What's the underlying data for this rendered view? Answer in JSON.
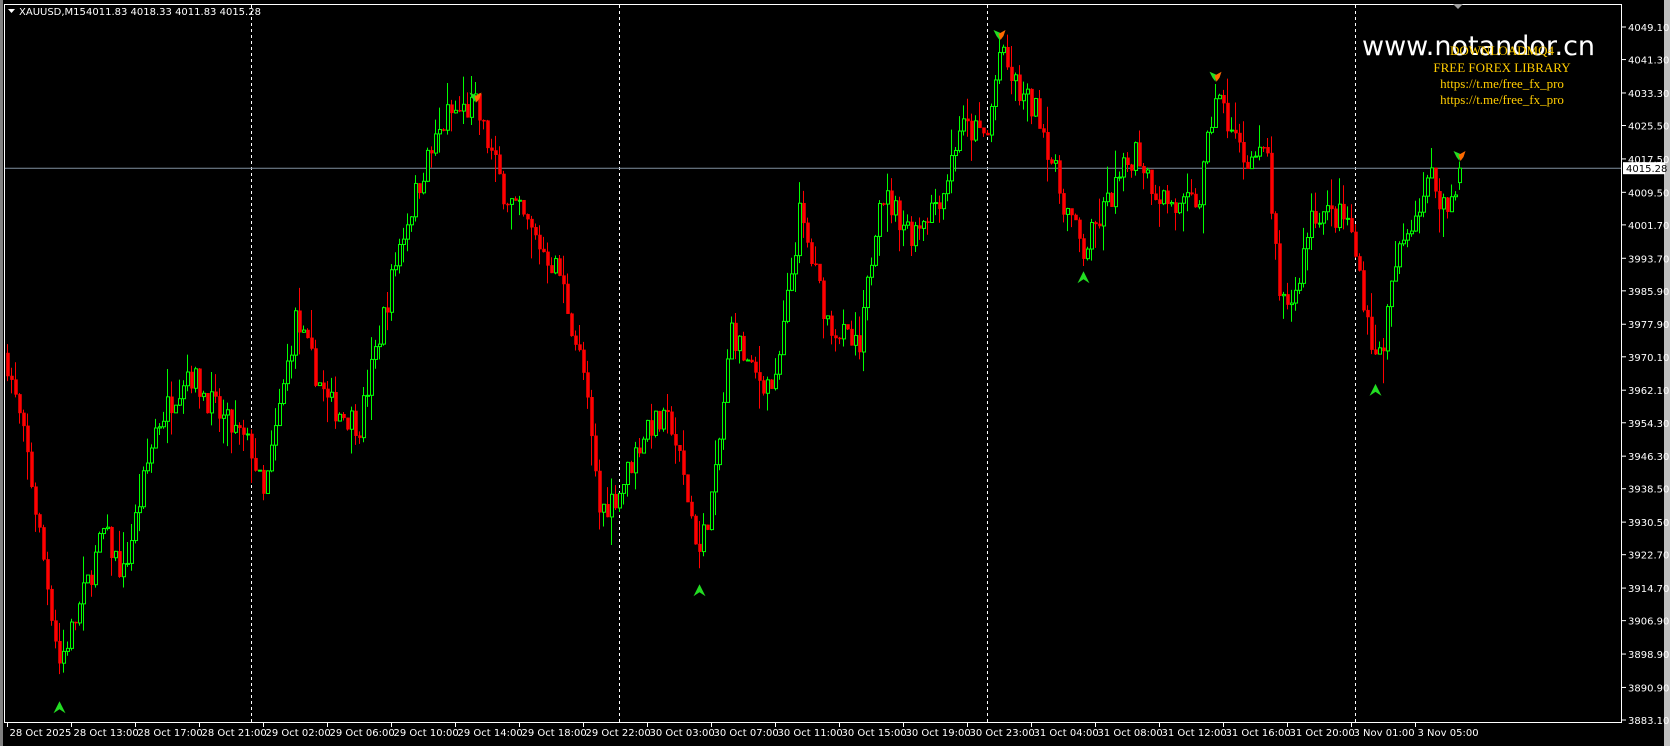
{
  "header": {
    "symbol": "XAUUSD,M15",
    "ohlc": "4011.83 4018.33 4011.83 4015.28"
  },
  "watermark": "www.notandor.cn",
  "ads": [
    "DOWNLOADMQ4",
    "FREE FOREX LIBRARY",
    "https://t.me/free_fx_pro",
    "https://t.me/free_fx_pro"
  ],
  "colors": {
    "bull": "#00ff00",
    "bear": "#ff0000",
    "background": "#000000",
    "axis": "#ffffff",
    "price_line": "#8090a0",
    "ad_text": "#ffcc00"
  },
  "chart_data": {
    "type": "candlestick",
    "symbol": "XAUUSD",
    "timeframe": "M15",
    "current_price": 4015.28,
    "current_price_label": "4015.28",
    "ylim": [
      3883.1,
      4049.1
    ],
    "y_ticks": [
      "4049.10",
      "4041.30",
      "4033.30",
      "4025.50",
      "4017.50",
      "4009.50",
      "4001.70",
      "3993.70",
      "3985.90",
      "3977.90",
      "3970.10",
      "3962.10",
      "3954.30",
      "3946.30",
      "3938.50",
      "3930.50",
      "3922.70",
      "3914.70",
      "3906.90",
      "3898.90",
      "3890.90",
      "3883.10"
    ],
    "x_ticks": [
      "28 Oct 2025",
      "28 Oct 13:00",
      "28 Oct 17:00",
      "28 Oct 21:00",
      "29 Oct 02:00",
      "29 Oct 06:00",
      "29 Oct 10:00",
      "29 Oct 14:00",
      "29 Oct 18:00",
      "29 Oct 22:00",
      "30 Oct 03:00",
      "30 Oct 07:00",
      "30 Oct 11:00",
      "30 Oct 15:00",
      "30 Oct 19:00",
      "30 Oct 23:00",
      "31 Oct 04:00",
      "31 Oct 08:00",
      "31 Oct 12:00",
      "31 Oct 16:00",
      "31 Oct 20:00",
      "3 Nov 01:00",
      "3 Nov 05:00"
    ],
    "bars_per_x_tick": 16,
    "day_separators_bar": [
      61,
      153,
      245,
      337
    ],
    "close_path_bar_price": [
      [
        0,
        3969
      ],
      [
        5,
        3946
      ],
      [
        13,
        3897
      ],
      [
        17,
        3907
      ],
      [
        24,
        3928
      ],
      [
        29,
        3918
      ],
      [
        37,
        3953
      ],
      [
        45,
        3967
      ],
      [
        53,
        3956
      ],
      [
        61,
        3948
      ],
      [
        64,
        3936
      ],
      [
        72,
        3979
      ],
      [
        80,
        3959
      ],
      [
        88,
        3954
      ],
      [
        98,
        3997
      ],
      [
        104,
        4015
      ],
      [
        110,
        4028
      ],
      [
        117,
        4030
      ],
      [
        124,
        4010
      ],
      [
        133,
        3997
      ],
      [
        138,
        3990
      ],
      [
        144,
        3966
      ],
      [
        148,
        3933
      ],
      [
        153,
        3938
      ],
      [
        160,
        3954
      ],
      [
        166,
        3954
      ],
      [
        173,
        3923
      ],
      [
        177,
        3941
      ],
      [
        181,
        3977
      ],
      [
        186,
        3966
      ],
      [
        192,
        3963
      ],
      [
        198,
        4004
      ],
      [
        205,
        3979
      ],
      [
        213,
        3971
      ],
      [
        218,
        4010
      ],
      [
        226,
        4000
      ],
      [
        234,
        4010
      ],
      [
        238,
        4025
      ],
      [
        245,
        4023
      ],
      [
        248,
        4043
      ],
      [
        253,
        4033
      ],
      [
        258,
        4028
      ],
      [
        263,
        4010
      ],
      [
        269,
        3995
      ],
      [
        274,
        4005
      ],
      [
        282,
        4020
      ],
      [
        287,
        4010
      ],
      [
        293,
        4005
      ],
      [
        298,
        4008
      ],
      [
        302,
        4033
      ],
      [
        309,
        4018
      ],
      [
        315,
        4018
      ],
      [
        318,
        3982
      ],
      [
        322,
        3985
      ],
      [
        326,
        4005
      ],
      [
        335,
        4003
      ],
      [
        338,
        3990
      ],
      [
        342,
        3969
      ],
      [
        344,
        3974
      ],
      [
        347,
        3992
      ],
      [
        351,
        4003
      ],
      [
        356,
        4013
      ],
      [
        360,
        4005
      ],
      [
        363,
        4015.28
      ]
    ],
    "buy_signals": [
      [
        13,
        3890
      ],
      [
        173,
        3918
      ],
      [
        269,
        3993
      ],
      [
        342,
        3966
      ]
    ],
    "sell_signals": [
      [
        117,
        4031
      ],
      [
        248,
        4046
      ],
      [
        302,
        4036
      ],
      [
        363,
        4017
      ]
    ]
  }
}
